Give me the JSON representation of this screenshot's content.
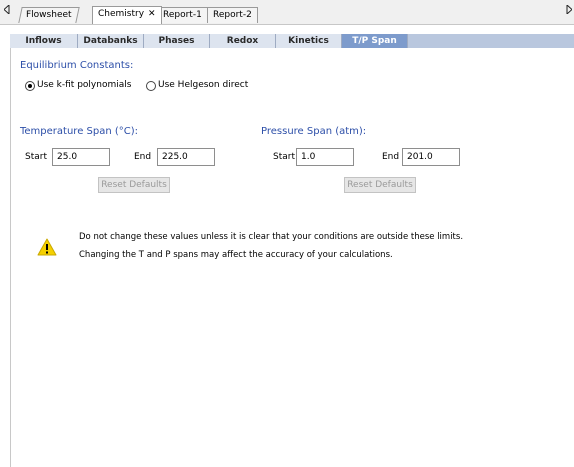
{
  "doc_tabs": [
    {
      "label": "Flowsheet",
      "closable": false,
      "active": false
    },
    {
      "label": "Chemistry",
      "closable": true,
      "active": true
    },
    {
      "label": "Report-1",
      "closable": false,
      "active": false
    },
    {
      "label": "Report-2",
      "closable": false,
      "active": false
    }
  ],
  "scroll": {
    "left_icon": "triangle-left-icon",
    "right_icon": "triangle-right-icon"
  },
  "inner_tabs": [
    {
      "label": "Inflows"
    },
    {
      "label": "Databanks"
    },
    {
      "label": "Phases"
    },
    {
      "label": "Redox"
    },
    {
      "label": "Kinetics"
    },
    {
      "label": "T/P Span",
      "active": true
    }
  ],
  "equilibrium": {
    "heading": "Equilibrium Constants:",
    "options": [
      {
        "label": "Use k-fit polynomials",
        "checked": true
      },
      {
        "label": "Use Helgeson direct",
        "checked": false
      }
    ]
  },
  "temperature": {
    "heading": "Temperature Span (°C):",
    "start_label": "Start",
    "start_value": "25.0",
    "end_label": "End",
    "end_value": "225.0",
    "reset_label": "Reset Defaults"
  },
  "pressure": {
    "heading": "Pressure Span (atm):",
    "start_label": "Start",
    "start_value": "1.0",
    "end_label": "End",
    "end_value": "201.0",
    "reset_label": "Reset Defaults"
  },
  "warning": {
    "icon": "warning-icon",
    "line1": "Do not change these values unless it is clear that your conditions are outside these limits.",
    "line2": "Changing the T and P spans may affect the accuracy of your calculations."
  },
  "colors": {
    "accent_blue": "#2d4fa8",
    "active_tab": "#7d9bcc",
    "warning_yellow": "#f5d000"
  }
}
